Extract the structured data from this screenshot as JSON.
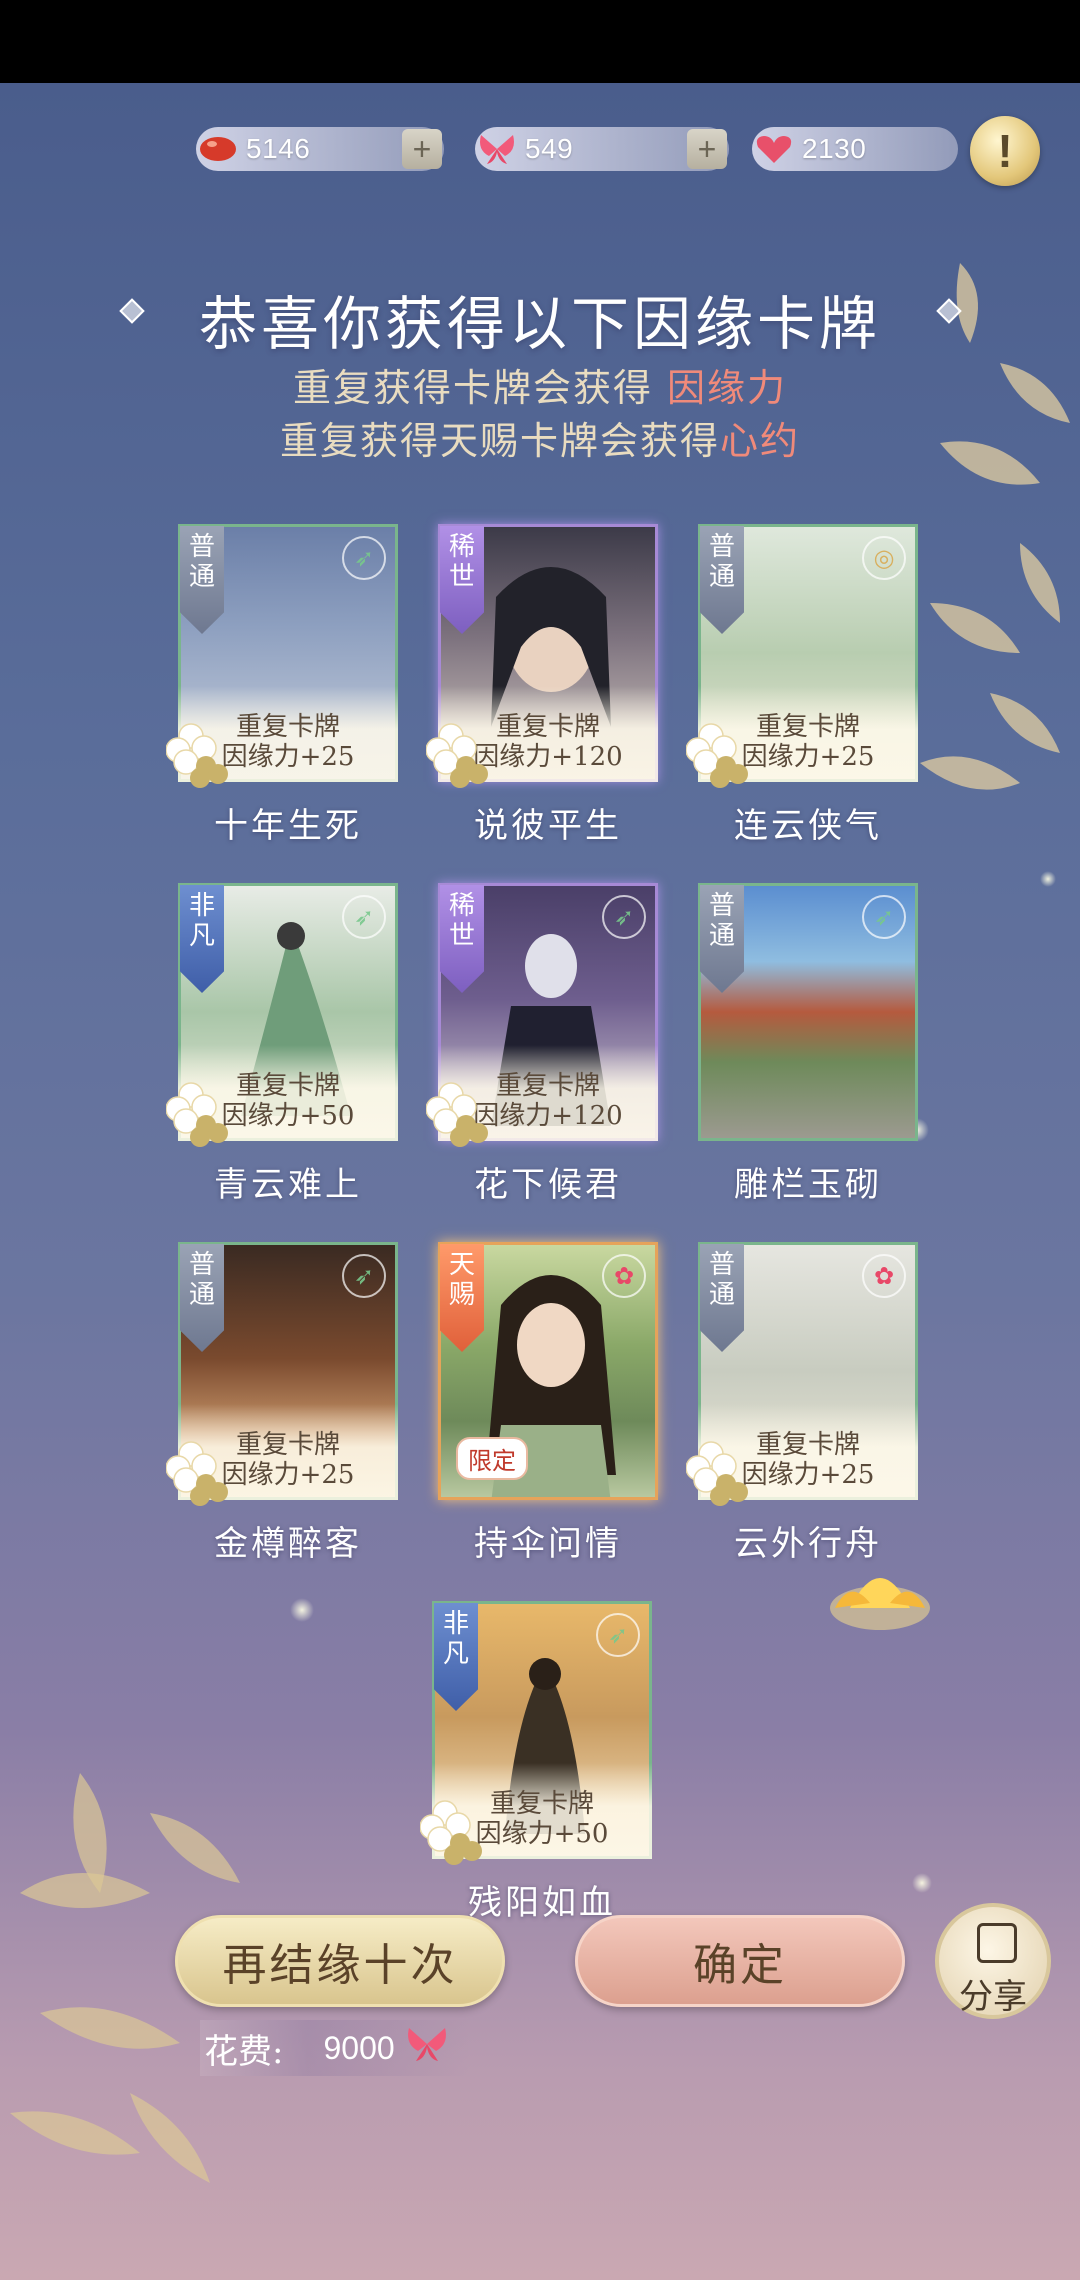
{
  "currencies": [
    {
      "name": "red-bean",
      "value": "5146",
      "has_plus": true,
      "color": "#d63a2a"
    },
    {
      "name": "butterfly",
      "value": "549",
      "has_plus": true,
      "color": "#f25a7a"
    },
    {
      "name": "heart",
      "value": "2130",
      "has_plus": false,
      "color": "#e8506a"
    }
  ],
  "plus_symbol": "+",
  "info_symbol": "!",
  "header": {
    "title": "恭喜你获得以下因缘卡牌",
    "line1_text": "重复获得卡牌会获得 ",
    "line1_highlight": "因缘力",
    "line2_text": "重复获得天赐卡牌会获得",
    "line2_highlight": "心约"
  },
  "cards": [
    {
      "rank": "普通",
      "rank_type": "common",
      "dup_title": "重复卡牌",
      "dup_reward": "因缘力+25",
      "name": "十年生死"
    },
    {
      "rank": "稀世",
      "rank_type": "rare",
      "dup_title": "重复卡牌",
      "dup_reward": "因缘力+120",
      "name": "说彼平生"
    },
    {
      "rank": "普通",
      "rank_type": "common",
      "dup_title": "重复卡牌",
      "dup_reward": "因缘力+25",
      "name": "连云侠气"
    },
    {
      "rank": "非凡",
      "rank_type": "uncommon",
      "dup_title": "重复卡牌",
      "dup_reward": "因缘力+50",
      "name": "青云难上"
    },
    {
      "rank": "稀世",
      "rank_type": "rare",
      "dup_title": "重复卡牌",
      "dup_reward": "因缘力+120",
      "name": "花下候君"
    },
    {
      "rank": "普通",
      "rank_type": "common",
      "dup_title": "",
      "dup_reward": "",
      "name": "雕栏玉砌"
    },
    {
      "rank": "普通",
      "rank_type": "common",
      "dup_title": "重复卡牌",
      "dup_reward": "因缘力+25",
      "name": "金樽醉客"
    },
    {
      "rank": "天赐",
      "rank_type": "heaven",
      "dup_title": "",
      "dup_reward": "",
      "name": "持伞问情",
      "limited": "限定"
    },
    {
      "rank": "普通",
      "rank_type": "common",
      "dup_title": "重复卡牌",
      "dup_reward": "因缘力+25",
      "name": "云外行舟"
    },
    {
      "rank": "非凡",
      "rank_type": "uncommon",
      "dup_title": "重复卡牌",
      "dup_reward": "因缘力+50",
      "name": "残阳如血"
    }
  ],
  "buttons": {
    "again": "再结缘十次",
    "confirm": "确定",
    "share": "分享"
  },
  "cost": {
    "label": "花费:",
    "value": "9000"
  }
}
